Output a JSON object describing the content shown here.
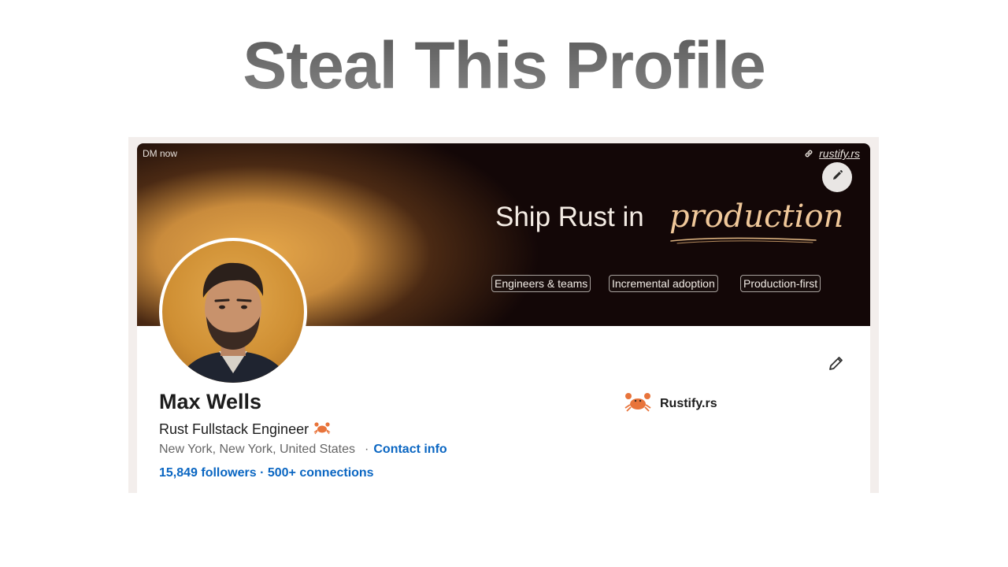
{
  "headline": "Steal This Profile",
  "banner": {
    "corner_label": "DM now",
    "link_text": "rustify.rs",
    "tagline": "Ship Rust in",
    "tagline_accent": "production",
    "chips": [
      "Engineers & teams",
      "Incremental adoption",
      "Production-first"
    ]
  },
  "profile": {
    "name": "Max Wells",
    "title": "Rust Fullstack Engineer",
    "title_emoji_icon": "crab-icon",
    "location": "New York, New York, United States",
    "separator": "·",
    "contact_label": "Contact info",
    "followers": "15,849 followers",
    "connections_separator": "·",
    "connections": "500+ connections",
    "company": "Rustify.rs",
    "company_logo_icon": "crab-icon"
  },
  "colors": {
    "link_blue": "#0a66c2",
    "banner_bg": "#130707",
    "banner_glow": "#e7a84a",
    "accent_text": "#f0c89a",
    "crab_orange": "#e8743b"
  },
  "icons": {
    "link": "link-icon",
    "edit_banner": "pencil-icon",
    "edit_profile": "pencil-icon"
  }
}
